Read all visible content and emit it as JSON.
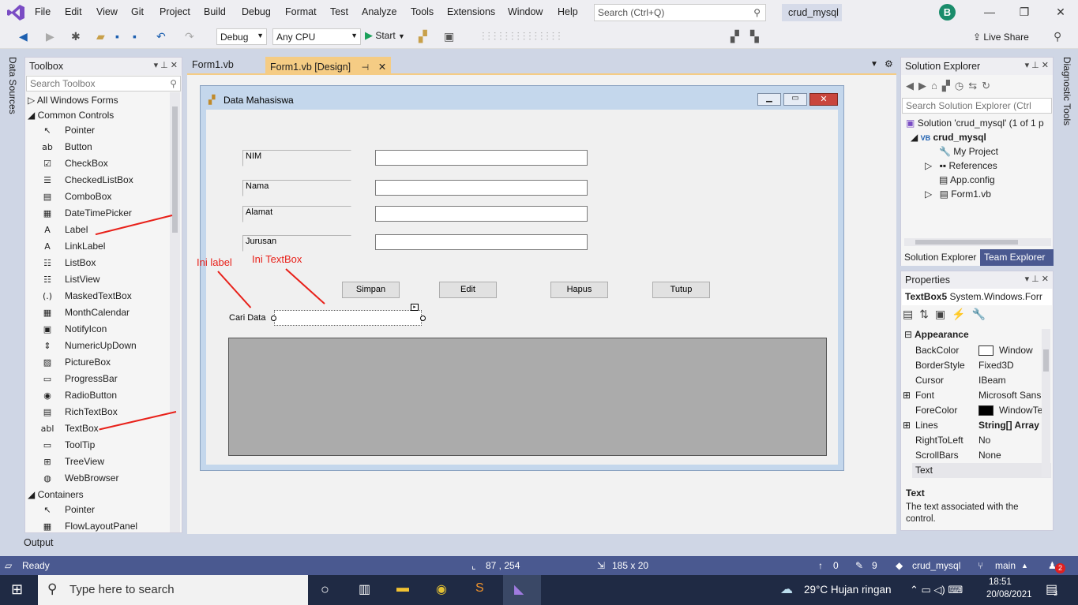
{
  "menubar": {
    "items": [
      "File",
      "Edit",
      "View",
      "Git",
      "Project",
      "Build",
      "Debug",
      "Format",
      "Test",
      "Analyze",
      "Tools",
      "Extensions",
      "Window",
      "Help"
    ],
    "search_placeholder": "Search (Ctrl+Q)",
    "project_title": "crud_mysql",
    "avatar_letter": "B"
  },
  "toolbar": {
    "config": "Debug",
    "platform": "Any CPU",
    "start_label": "Start",
    "live_share": "Live Share"
  },
  "left_rail": {
    "label": "Data Sources"
  },
  "right_rail": {
    "label": "Diagnostic Tools"
  },
  "toolbox": {
    "title": "Toolbox",
    "search_placeholder": "Search Toolbox",
    "group_all": "All Windows Forms",
    "group_common": "Common Controls",
    "items": [
      {
        "icon": "pointer-icon",
        "glyph": "↖",
        "label": "Pointer"
      },
      {
        "icon": "button-icon",
        "glyph": "ab",
        "label": "Button"
      },
      {
        "icon": "checkbox-icon",
        "glyph": "☑",
        "label": "CheckBox"
      },
      {
        "icon": "checkedlistbox-icon",
        "glyph": "☰",
        "label": "CheckedListBox"
      },
      {
        "icon": "combobox-icon",
        "glyph": "▤",
        "label": "ComboBox"
      },
      {
        "icon": "datetimepicker-icon",
        "glyph": "▦",
        "label": "DateTimePicker"
      },
      {
        "icon": "label-icon",
        "glyph": "A",
        "label": "Label"
      },
      {
        "icon": "linklabel-icon",
        "glyph": "A",
        "label": "LinkLabel"
      },
      {
        "icon": "listbox-icon",
        "glyph": "☷",
        "label": "ListBox"
      },
      {
        "icon": "listview-icon",
        "glyph": "☷",
        "label": "ListView"
      },
      {
        "icon": "maskedtextbox-icon",
        "glyph": "(.)",
        "label": "MaskedTextBox"
      },
      {
        "icon": "monthcalendar-icon",
        "glyph": "▦",
        "label": "MonthCalendar"
      },
      {
        "icon": "notifyicon-icon",
        "glyph": "▣",
        "label": "NotifyIcon"
      },
      {
        "icon": "numericupdown-icon",
        "glyph": "⇕",
        "label": "NumericUpDown"
      },
      {
        "icon": "picturebox-icon",
        "glyph": "▨",
        "label": "PictureBox"
      },
      {
        "icon": "progressbar-icon",
        "glyph": "▭",
        "label": "ProgressBar"
      },
      {
        "icon": "radiobutton-icon",
        "glyph": "◉",
        "label": "RadioButton"
      },
      {
        "icon": "richtextbox-icon",
        "glyph": "▤",
        "label": "RichTextBox"
      },
      {
        "icon": "textbox-icon",
        "glyph": "abl",
        "label": "TextBox"
      },
      {
        "icon": "tooltip-icon",
        "glyph": "▭",
        "label": "ToolTip"
      },
      {
        "icon": "treeview-icon",
        "glyph": "⊞",
        "label": "TreeView"
      },
      {
        "icon": "webbrowser-icon",
        "glyph": "◍",
        "label": "WebBrowser"
      }
    ],
    "group_containers": "Containers",
    "container_items": [
      {
        "icon": "pointer-icon",
        "glyph": "↖",
        "label": "Pointer"
      },
      {
        "icon": "flowlayoutpanel-icon",
        "glyph": "▦",
        "label": "FlowLayoutPanel"
      }
    ]
  },
  "tabs": {
    "tab1": "Form1.vb",
    "tab2": "Form1.vb [Design]"
  },
  "form": {
    "title": "Data Mahasiswa",
    "labels": [
      "NIM",
      "Nama",
      "Alamat",
      "Jurusan"
    ],
    "buttons": [
      "Simpan",
      "Edit",
      "Hapus",
      "Tutup"
    ],
    "search_label": "Cari Data"
  },
  "annotations": {
    "label_note": "Ini label",
    "textbox_note": "Ini TextBox"
  },
  "solution_explorer": {
    "title": "Solution Explorer",
    "search_placeholder": "Search Solution Explorer (Ctrl",
    "solution": "Solution 'crud_mysql' (1 of 1 p",
    "project": "crud_mysql",
    "items": [
      "My Project",
      "References",
      "App.config",
      "Form1.vb"
    ],
    "tab_solution": "Solution Explorer",
    "tab_team": "Team Explorer"
  },
  "properties": {
    "title": "Properties",
    "object": "TextBox5",
    "object_type": "System.Windows.Forr",
    "category": "Appearance",
    "rows": [
      {
        "name": "BackColor",
        "value": "Window",
        "swatch": "#ffffff"
      },
      {
        "name": "BorderStyle",
        "value": "Fixed3D"
      },
      {
        "name": "Cursor",
        "value": "IBeam"
      },
      {
        "name": "Font",
        "value": "Microsoft Sans"
      },
      {
        "name": "ForeColor",
        "value": "WindowTe",
        "swatch": "#000000"
      },
      {
        "name": "Lines",
        "value": "String[] Array"
      },
      {
        "name": "RightToLeft",
        "value": "No"
      },
      {
        "name": "ScrollBars",
        "value": "None"
      },
      {
        "name": "Text",
        "value": ""
      }
    ],
    "desc_title": "Text",
    "desc_text": "The text associated with the control."
  },
  "output_tab": "Output",
  "statusbar": {
    "ready": "Ready",
    "position": "87 , 254",
    "size": "185 x 20",
    "up_count": "0",
    "pencil_count": "9",
    "repo": "crud_mysql",
    "branch": "main",
    "notif": "2"
  },
  "taskbar": {
    "search_placeholder": "Type here to search",
    "weather": "29°C  Hujan ringan",
    "time": "18:51",
    "date": "20/08/2021",
    "notif_count": "3"
  },
  "colors": {
    "accent": "#f5cc84",
    "statusbar": "#4a5990",
    "annotation": "#e8211a"
  }
}
